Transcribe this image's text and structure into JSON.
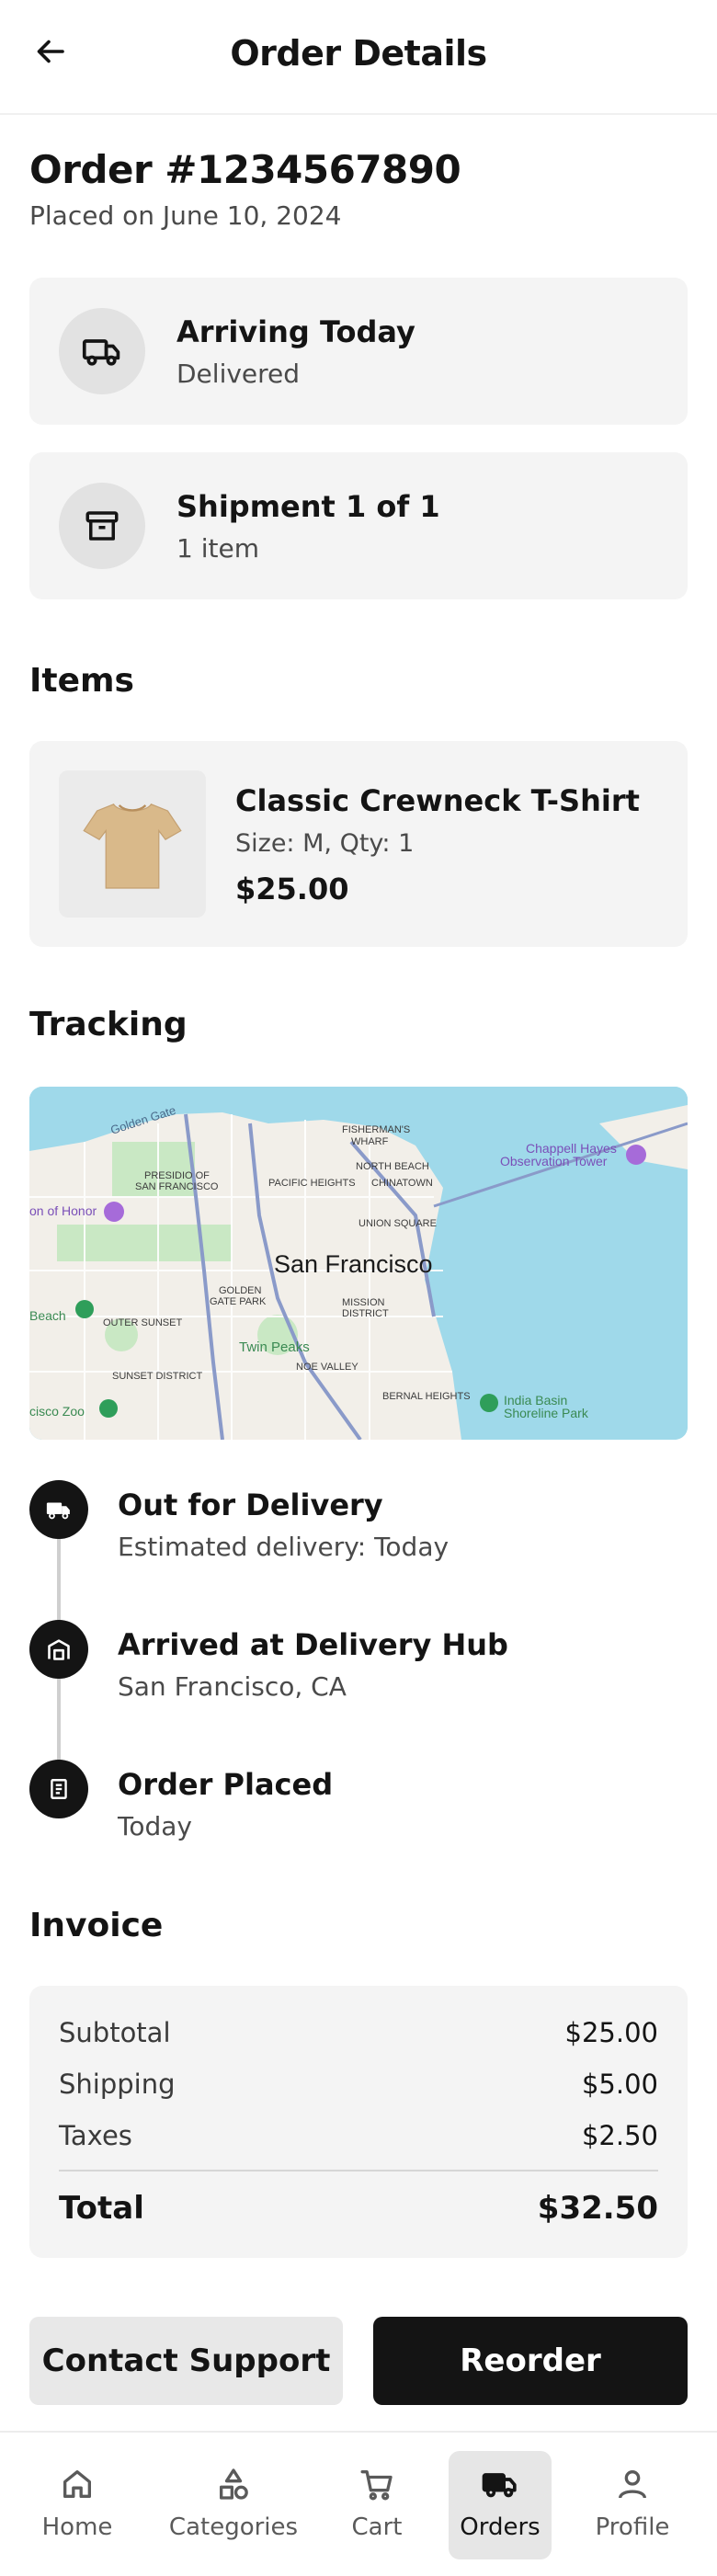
{
  "header": {
    "title": "Order Details",
    "back_icon": "arrow-left-icon"
  },
  "order": {
    "title": "Order #1234567890",
    "placed_on": "Placed on June 10, 2024"
  },
  "status_cards": [
    {
      "title": "Arriving Today",
      "subtitle": "Delivered",
      "icon": "truck-icon"
    },
    {
      "title": "Shipment 1 of 1",
      "subtitle": "1 item",
      "icon": "archive-box-icon"
    }
  ],
  "items_section": {
    "title": "Items",
    "items": [
      {
        "name": "Classic Crewneck T-Shirt",
        "meta": "Size: M, Qty: 1",
        "price": "$25.00",
        "thumb_color": "#d9b98a"
      }
    ]
  },
  "tracking": {
    "title": "Tracking",
    "map": {
      "city": "San Francisco",
      "labels": [
        "Golden Gate",
        "FISHERMAN'S WHARF",
        "NORTH BEACH",
        "PACIFIC HEIGHTS",
        "CHINATOWN",
        "PRESIDIO OF SAN FRANCISCO",
        "UNION SQUARE",
        "Chappell Hayes Observation Tower",
        "on of Honor",
        "GOLDEN GATE PARK",
        "MISSION DISTRICT",
        "Beach",
        "OUTER SUNSET",
        "Twin Peaks",
        "NOE VALLEY",
        "SUNSET DISTRICT",
        "BERNAL HEIGHTS",
        "India Basin Shoreline Park",
        "cisco Zoo"
      ]
    },
    "events": [
      {
        "title": "Out for Delivery",
        "subtitle": "Estimated delivery: Today",
        "icon": "truck-icon"
      },
      {
        "title": "Arrived at Delivery Hub",
        "subtitle": "San Francisco, CA",
        "icon": "warehouse-icon"
      },
      {
        "title": "Order Placed",
        "subtitle": "Today",
        "icon": "receipt-icon"
      }
    ]
  },
  "invoice": {
    "title": "Invoice",
    "rows": [
      {
        "label": "Subtotal",
        "value": "$25.00"
      },
      {
        "label": "Shipping",
        "value": "$5.00"
      },
      {
        "label": "Taxes",
        "value": "$2.50"
      }
    ],
    "total_label": "Total",
    "total_value": "$32.50"
  },
  "actions": {
    "contact_label": "Contact Support",
    "reorder_label": "Reorder"
  },
  "bottom_nav": {
    "items": [
      {
        "label": "Home",
        "icon": "home-icon",
        "active": false
      },
      {
        "label": "Categories",
        "icon": "categories-icon",
        "active": false
      },
      {
        "label": "Cart",
        "icon": "cart-icon",
        "active": false
      },
      {
        "label": "Orders",
        "icon": "truck-icon",
        "active": true
      },
      {
        "label": "Profile",
        "icon": "profile-icon",
        "active": false
      }
    ]
  },
  "colors": {
    "primary": "#141414",
    "card_bg": "#f4f4f4",
    "water": "#9fd9ea",
    "land": "#f2efe9",
    "park": "#c9e8c4"
  }
}
